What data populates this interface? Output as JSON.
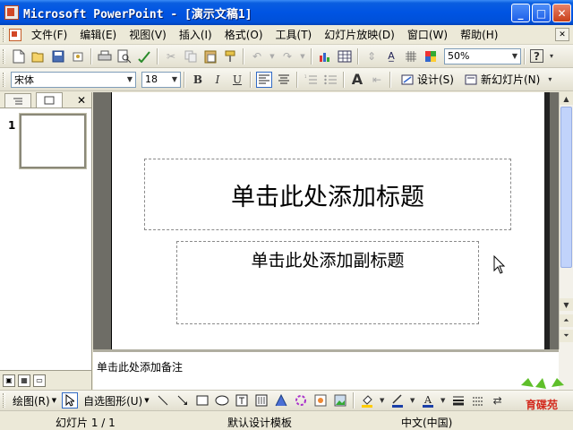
{
  "window": {
    "title": "Microsoft PowerPoint - [演示文稿1]",
    "min_label": "_",
    "max_label": "□",
    "close_label": "✕"
  },
  "menu": {
    "items": [
      "文件(F)",
      "编辑(E)",
      "视图(V)",
      "插入(I)",
      "格式(O)",
      "工具(T)",
      "幻灯片放映(D)",
      "窗口(W)",
      "帮助(H)"
    ]
  },
  "toolbar_standard": {
    "zoom": "50%",
    "help": "?"
  },
  "toolbar_formatting": {
    "font": "宋体",
    "size": "18",
    "bold": "B",
    "italic": "I",
    "underline": "U",
    "grow_font": "A",
    "design_label": "设计(S)",
    "new_slide_label": "新幻灯片(N)"
  },
  "left_pane": {
    "slide_number": "1"
  },
  "slide": {
    "title_placeholder": "单击此处添加标题",
    "subtitle_placeholder": "单击此处添加副标题"
  },
  "notes": {
    "placeholder": "单击此处添加备注"
  },
  "toolbar_drawing": {
    "draw_label": "绘图(R)",
    "autoshapes_label": "自选图形(U)"
  },
  "statusbar": {
    "slide_info": "幻灯片 1 / 1",
    "template": "默认设计模板",
    "language": "中文(中国)"
  },
  "logo": {
    "text": "育碟苑"
  }
}
